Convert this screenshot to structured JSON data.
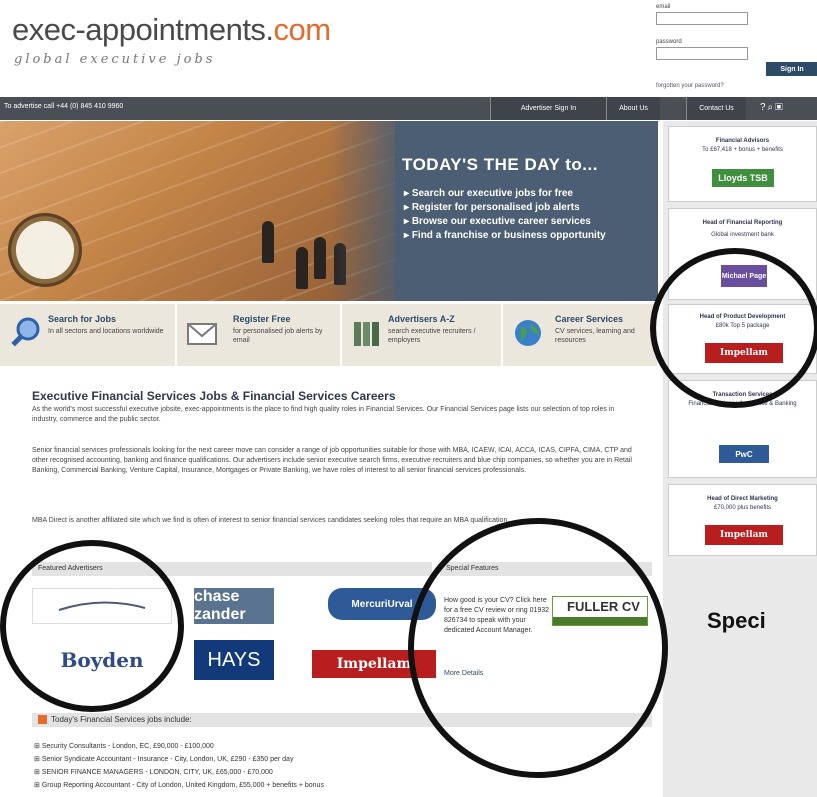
{
  "header": {
    "logo_main": "exec-appointments.",
    "logo_com": "com",
    "tagline": "global executive jobs",
    "login": {
      "email_label": "email",
      "password_label": "password",
      "signin_label": "Sign In",
      "forgot_label": "forgotten your password?"
    }
  },
  "navbar": {
    "call_text": "To advertise call +44 (0) 845 410 9960",
    "links": [
      "Advertiser Sign In",
      "About Us",
      "Contact Us"
    ]
  },
  "hero": {
    "headline": "TODAY'S THE DAY to...",
    "bullets": [
      "Search our executive jobs for free",
      "Register for personalised job alerts",
      "Browse our executive career services",
      "Find a franchise or business opportunity"
    ]
  },
  "features": [
    {
      "title": "Search for Jobs",
      "desc": "In all sectors and locations worldwide"
    },
    {
      "title": "Register Free",
      "desc": "for personalised job alerts by email"
    },
    {
      "title": "Advertisers A-Z",
      "desc": "search executive recruiters / employers"
    },
    {
      "title": "Career Services",
      "desc": "CV services, learning and resources"
    }
  ],
  "article": {
    "title": "Executive Financial Services Jobs & Financial Services Careers",
    "p1": "As the world's most successful executive jobsite, exec-appointments is the place to find high quality roles in Financial Services. Our Financial Services page lists our selection of top roles in industry, commerce and the public sector.",
    "p2": "Senior financial services professionals looking for the next career move can consider a range of job opportunities suitable for those with MBA, ICAEW, ICAI, ACCA, ICAS, CIPFA, CIMA, CTP and other recognised accounting, banking and finance qualifications. Our advertisers include senior executive search firms, executive recruiters and blue chip companies, so whether you are in Retail Banking, Commercial Banking, Venture Capital, Insurance, Mortgages or Private Banking, we have roles of interest to all senior financial services professionals.",
    "p3": "MBA Direct is another affiliated site which we find is often of interest to senior financial services candidates seeking roles that require an MBA qualification."
  },
  "featured_advertisers": {
    "heading": "Featured Advertisers",
    "logos": [
      "Boyden",
      "chase zander",
      "HAYS",
      "MercuriUrval",
      "Impellam"
    ]
  },
  "special_features": {
    "heading": "Special Features",
    "text": "How good is your CV? Click here for a free CV review or ring 01932 826734 to speak with your dedicated Account Manager.",
    "more": "More Details",
    "logo": "FULLER CV"
  },
  "jobs": {
    "heading": "Today's Financial Services jobs include:",
    "items": [
      "Security Consultants - London, EC, £90,000 - £100,000",
      "Senior Syndicate Accountant - Insurance - City, London, UK, £290 - £350 per day",
      "SENIOR FINANCE MANAGERS - LONDON, CITY, UK, £65,000 - £70,000",
      "Group Reporting Accountant - City of London, United Kingdom, £55,000 + benefits + bonus"
    ]
  },
  "sidebar": {
    "boxes": [
      {
        "title": "Financial Advisors",
        "sub": "To £67,418 + bonus + benefits",
        "logo": "Lloyds TSB"
      },
      {
        "title": "Head of Financial Reporting",
        "sub": "Global investment bank",
        "logo": "Michael Page"
      },
      {
        "title": "Head of Product Development",
        "sub": "£80k Top 5 package",
        "logo": "Impellam"
      },
      {
        "title": "Transaction Services",
        "sub": "Financial Advisory, Assurance & Banking",
        "logo": "PwC"
      },
      {
        "title": "Head of Direct Marketing",
        "sub": "£70,000 plus benefits",
        "logo": "Impellam"
      }
    ],
    "specials_label": "Speci"
  },
  "colors": {
    "nav": "#4a4f55",
    "brand_blue": "#2d4a67",
    "accent_orange": "#e8692a",
    "impellam_red": "#b81e1e"
  }
}
